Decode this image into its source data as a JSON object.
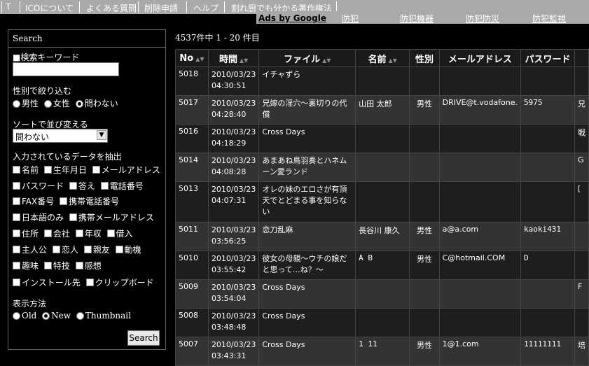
{
  "topnav": {
    "items": [
      "T",
      "ICOについて",
      "よくある質問",
      "削除申請",
      "ヘルプ",
      "割れ厨でも分かる著作権法"
    ]
  },
  "ads": {
    "label": "Ads by Google",
    "links": [
      "防犯",
      "防犯機器",
      "防犯防災",
      "防犯監視"
    ]
  },
  "sidebar": {
    "title": "Search",
    "keyword_label": "■検索キーワード",
    "keyword_value": "",
    "gender_label": "性別で絞り込む",
    "gender_options": [
      "男性",
      "女性",
      "問わない"
    ],
    "gender_selected": "問わない",
    "sort_label": "ソートで並び変える",
    "sort_value": "問わない",
    "extract_label": "入力されているデータを抽出",
    "checkboxes": [
      [
        "名前",
        "生年月日",
        "メールアドレス"
      ],
      [
        "パスワード",
        "答え",
        "電話番号"
      ],
      [
        "FAX番号",
        "携帯電話番号"
      ],
      [
        "日本語のみ",
        "携帯メールアドレス"
      ],
      [
        "住所",
        "会社",
        "年収",
        "借入"
      ],
      [
        "主人公",
        "恋人",
        "親友",
        "動機"
      ],
      [
        "趣味",
        "特技",
        "感想"
      ],
      [
        "インストール先",
        "クリップボード"
      ]
    ],
    "display_label": "表示方法",
    "display_options": [
      "Old",
      "New",
      "Thumbnail"
    ],
    "display_selected": "New",
    "search_button": "Search"
  },
  "results": {
    "count_text": "4537件中 1 - 20 件目",
    "columns": [
      "No",
      "時間",
      "ファイル",
      "名前",
      "性別",
      "メールアドレス",
      "パスワード"
    ],
    "rows": [
      {
        "no": "5018",
        "date": "2010/03/23",
        "time": "04:30:51",
        "file": "イチャずら",
        "name": "",
        "sex": "",
        "mail": "",
        "pass": "",
        "extra": ""
      },
      {
        "no": "5017",
        "date": "2010/03/23",
        "time": "04:28:40",
        "file": "兄嫁の淫穴～裏切りの代償",
        "name": "山田 太郎",
        "sex": "男性",
        "mail": "DRIVE@t.vodafone.",
        "pass": "5975",
        "extra": "兄"
      },
      {
        "no": "5016",
        "date": "2010/03/23",
        "time": "04:18:29",
        "file": "Cross Days",
        "name": "",
        "sex": "",
        "mail": "",
        "pass": "",
        "extra": "戦"
      },
      {
        "no": "5014",
        "date": "2010/03/23",
        "time": "04:08:28",
        "file": "あまあね鳥羽奏とハネムーン愛ランド",
        "name": "",
        "sex": "",
        "mail": "",
        "pass": "",
        "extra": "G"
      },
      {
        "no": "5013",
        "date": "2010/03/23",
        "time": "04:07:31",
        "file": "オレの妹のエロさが有頂天でとどまる事を知らない",
        "name": "",
        "sex": "",
        "mail": "",
        "pass": "",
        "extra": "["
      },
      {
        "no": "5011",
        "date": "2010/03/23",
        "time": "03:56:25",
        "file": "恋刀乱麻",
        "name": "長谷川 康久",
        "sex": "男性",
        "mail": "a@a.com",
        "pass": "kaoki431",
        "extra": ""
      },
      {
        "no": "5010",
        "date": "2010/03/23",
        "time": "03:55:42",
        "file": "彼女の母親～ウチの娘だと思って…ね？～",
        "name": "A B",
        "sex": "男性",
        "mail": "C@hotmail.COM",
        "pass": "D",
        "extra": ""
      },
      {
        "no": "5009",
        "date": "2010/03/23",
        "time": "03:54:04",
        "file": "Cross Days",
        "name": "",
        "sex": "",
        "mail": "",
        "pass": "",
        "extra": "F"
      },
      {
        "no": "5008",
        "date": "2010/03/23",
        "time": "03:48:48",
        "file": "Cross Days",
        "name": "",
        "sex": "",
        "mail": "",
        "pass": "",
        "extra": ""
      },
      {
        "no": "5007",
        "date": "2010/03/23",
        "time": "03:43:31",
        "file": "Cross Days",
        "name": "1 11",
        "sex": "男性",
        "mail": "1@1.com",
        "pass": "11111111",
        "extra": "培"
      }
    ]
  }
}
